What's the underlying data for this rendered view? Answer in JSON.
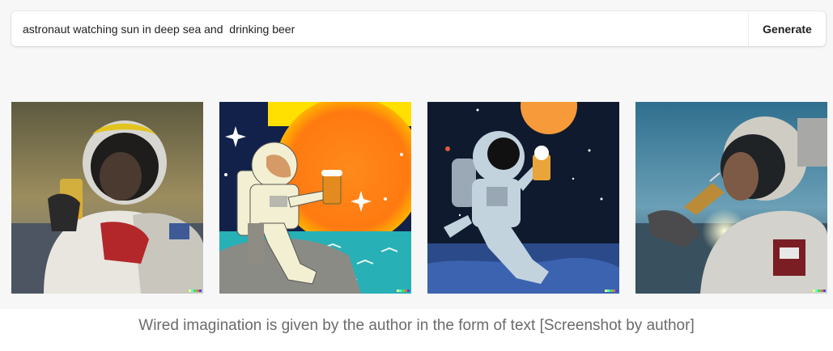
{
  "prompt": {
    "value": "astronaut watching sun in deep sea and  drinking beer",
    "button_label": "Generate"
  },
  "results": {
    "images": [
      {
        "style": "photo",
        "subject": "astronaut in helmet holding glass of beer at sunset over sea"
      },
      {
        "style": "cartoon",
        "subject": "astronaut sitting on rock raising beer mug under orange sun and stars"
      },
      {
        "style": "illustration",
        "subject": "astronaut sitting on blue surface holding beer mug under sun"
      },
      {
        "style": "photo",
        "subject": "astronaut in helmet drinking from glass with straw at sea horizon"
      }
    ],
    "signature_colors": [
      "#ffff66",
      "#42ffff",
      "#51da4c",
      "#ff6e3c",
      "#3c46ff"
    ]
  },
  "caption": "Wired imagination is given by the author in the form of text [Screenshot by author]"
}
